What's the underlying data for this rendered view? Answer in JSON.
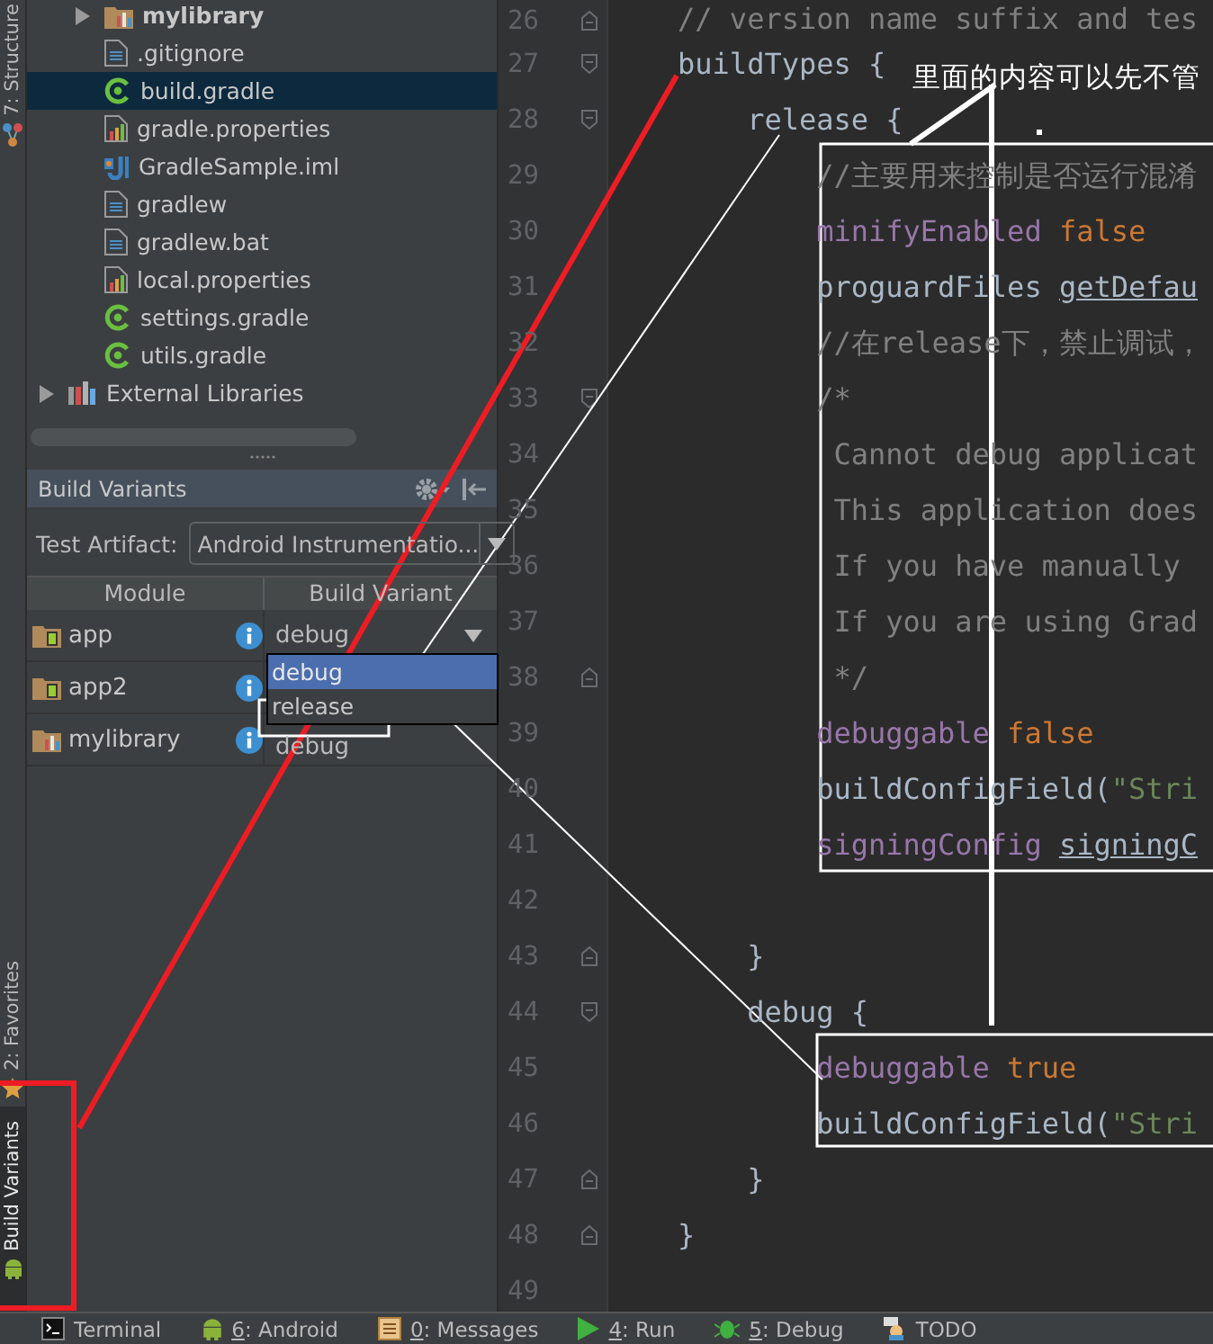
{
  "side_strip": {
    "top_tabs": [
      {
        "label": "7: Structure",
        "kind": "structure",
        "selected": false
      }
    ],
    "bottom_tabs": [
      {
        "label": "2: Favorites",
        "kind": "star",
        "selected": false
      },
      {
        "label": "Build Variants",
        "kind": "android",
        "selected": true
      }
    ]
  },
  "project_tree": {
    "nested_items": [
      {
        "label": "mylibrary",
        "kind": "module",
        "expanded": false,
        "selected": false
      },
      {
        "label": ".gitignore",
        "kind": "text",
        "selected": false
      },
      {
        "label": "build.gradle",
        "kind": "gradle",
        "selected": true
      },
      {
        "label": "gradle.properties",
        "kind": "properties",
        "selected": false
      },
      {
        "label": "GradleSample.iml",
        "kind": "iml",
        "selected": false
      },
      {
        "label": "gradlew",
        "kind": "text",
        "selected": false
      },
      {
        "label": "gradlew.bat",
        "kind": "text",
        "selected": false
      },
      {
        "label": "local.properties",
        "kind": "properties",
        "selected": false
      },
      {
        "label": "settings.gradle",
        "kind": "gradle",
        "selected": false
      },
      {
        "label": "utils.gradle",
        "kind": "gradle",
        "selected": false
      }
    ],
    "root_items": [
      {
        "label": "External Libraries",
        "kind": "libraries",
        "expanded": false,
        "selected": false
      }
    ]
  },
  "build_variants": {
    "title": "Build Variants",
    "test_artifact": {
      "label": "Test Artifact:",
      "value": "Android Instrumentatio..."
    },
    "columns": [
      "Module",
      "Build Variant"
    ],
    "rows": [
      {
        "module": "app",
        "kind": "app",
        "variant": "debug",
        "open": true
      },
      {
        "module": "app2",
        "kind": "app",
        "open": false
      },
      {
        "module": "mylibrary",
        "kind": "library",
        "variant": "debug",
        "open": false
      }
    ],
    "popup_options": [
      {
        "label": "debug",
        "selected": true
      },
      {
        "label": "release",
        "selected": false
      }
    ]
  },
  "editor": {
    "lines": [
      {
        "number": "26",
        "kind": "block-end",
        "tokens": [
          {
            "kind": "comment",
            "text": "    // version name suffix and tes"
          }
        ]
      },
      {
        "number": "27",
        "kind": "block-start",
        "tokens": [
          {
            "kind": "plain",
            "text": "    buildTypes {"
          }
        ]
      },
      {
        "number": "28",
        "kind": "block-start",
        "tokens": [
          {
            "kind": "plain",
            "text": "        release {"
          }
        ]
      },
      {
        "number": "29",
        "kind": "line",
        "tokens": [
          {
            "kind": "comment",
            "text": "            //主要用来控制是否运行混淆"
          }
        ]
      },
      {
        "number": "30",
        "kind": "line",
        "tokens": [
          {
            "kind": "keyword",
            "text": "            minifyEnabled"
          },
          {
            "kind": "literal",
            "text": " false"
          }
        ]
      },
      {
        "number": "31",
        "kind": "line",
        "tokens": [
          {
            "kind": "plain",
            "text": "            proguardFiles "
          },
          {
            "kind": "link",
            "text": "getDefau"
          }
        ]
      },
      {
        "number": "32",
        "kind": "line",
        "tokens": [
          {
            "kind": "comment",
            "text": "            //在release下，禁止调试，"
          }
        ]
      },
      {
        "number": "33",
        "kind": "block-start",
        "tokens": [
          {
            "kind": "comment",
            "text": "            /*"
          }
        ]
      },
      {
        "number": "34",
        "kind": "line",
        "tokens": [
          {
            "kind": "comment",
            "text": "             Cannot debug applicat"
          }
        ]
      },
      {
        "number": "35",
        "kind": "line",
        "tokens": [
          {
            "kind": "comment",
            "text": "             This application does"
          }
        ]
      },
      {
        "number": "36",
        "kind": "line",
        "tokens": [
          {
            "kind": "comment",
            "text": "             If you have manually"
          }
        ]
      },
      {
        "number": "37",
        "kind": "line",
        "tokens": [
          {
            "kind": "comment",
            "text": "             If you are using Grad"
          }
        ]
      },
      {
        "number": "38",
        "kind": "block-end",
        "tokens": [
          {
            "kind": "comment",
            "text": "             */"
          }
        ]
      },
      {
        "number": "39",
        "kind": "line",
        "tokens": [
          {
            "kind": "keyword",
            "text": "            debuggable"
          },
          {
            "kind": "literal",
            "text": " false"
          }
        ]
      },
      {
        "number": "40",
        "kind": "line",
        "tokens": [
          {
            "kind": "plain",
            "text": "            buildConfigField("
          },
          {
            "kind": "string",
            "text": "\"Stri"
          }
        ]
      },
      {
        "number": "41",
        "kind": "line",
        "tokens": [
          {
            "kind": "keyword",
            "text": "            signingConfig "
          },
          {
            "kind": "link",
            "text": "signingC"
          }
        ]
      },
      {
        "number": "42",
        "kind": "line"
      },
      {
        "number": "43",
        "kind": "block-end",
        "tokens": [
          {
            "kind": "plain",
            "text": "        }"
          }
        ]
      },
      {
        "number": "44",
        "kind": "block-start",
        "tokens": [
          {
            "kind": "plain",
            "text": "        debug {"
          }
        ]
      },
      {
        "number": "45",
        "kind": "line",
        "tokens": [
          {
            "kind": "keyword",
            "text": "            debuggable"
          },
          {
            "kind": "literal",
            "text": " true"
          }
        ]
      },
      {
        "number": "46",
        "kind": "line",
        "tokens": [
          {
            "kind": "plain",
            "text": "            buildConfigField("
          },
          {
            "kind": "string",
            "text": "\"Stri"
          }
        ]
      },
      {
        "number": "47",
        "kind": "block-end",
        "tokens": [
          {
            "kind": "plain",
            "text": "        }"
          }
        ]
      },
      {
        "number": "48",
        "kind": "block-end",
        "tokens": [
          {
            "kind": "plain",
            "text": "    }"
          }
        ]
      },
      {
        "number": "49",
        "kind": "line"
      }
    ]
  },
  "bottom_bar": [
    {
      "label": "Terminal",
      "kind": "terminal",
      "underline_key": false
    },
    {
      "label": "6: Android",
      "kind": "android",
      "underline_key": true
    },
    {
      "label": "0: Messages",
      "kind": "messages",
      "underline_key": true
    },
    {
      "label": "4: Run",
      "kind": "run",
      "underline_key": true
    },
    {
      "label": "5: Debug",
      "kind": "debug",
      "underline_key": true
    },
    {
      "label": "TODO",
      "kind": "todo",
      "underline_key": false
    }
  ],
  "annotation": {
    "callout": "里面的内容可以先不管"
  }
}
